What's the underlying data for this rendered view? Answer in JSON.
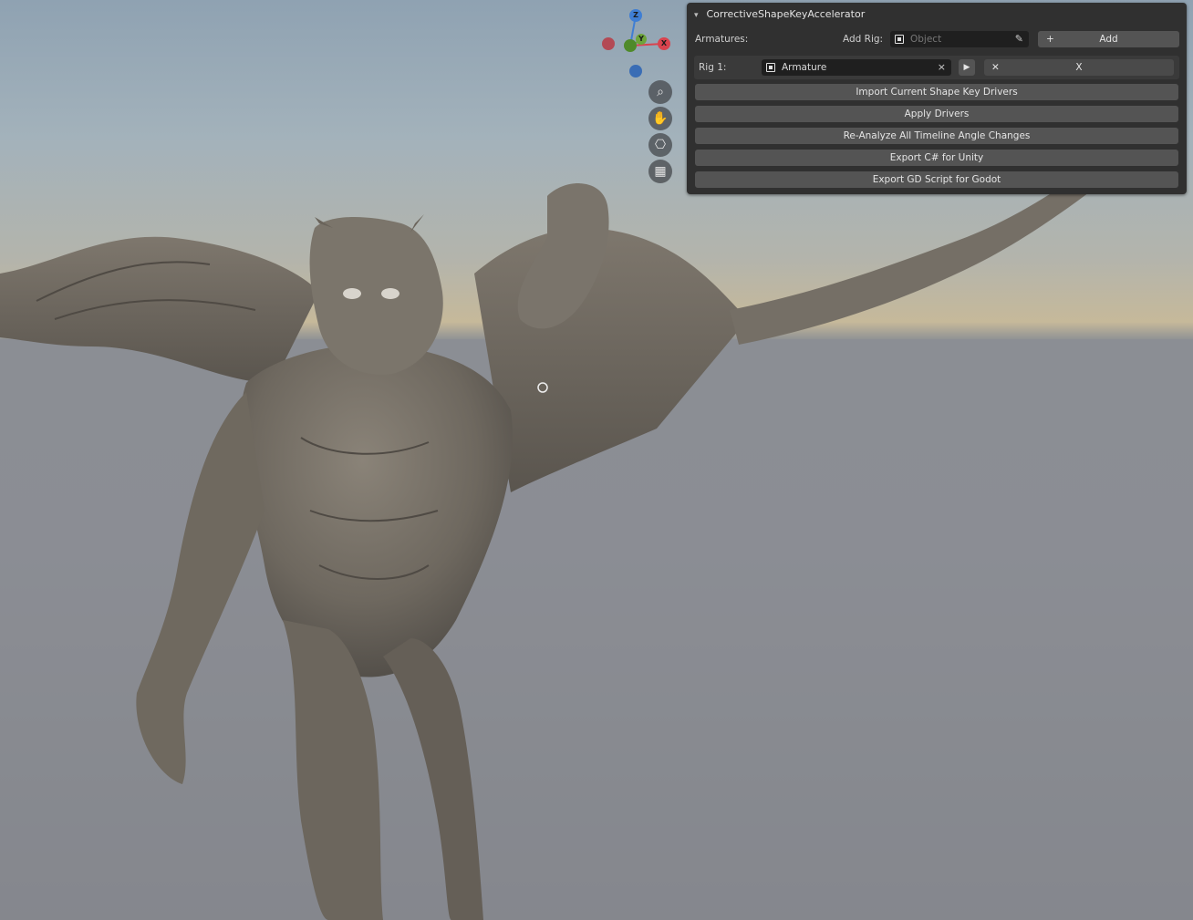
{
  "panel": {
    "title": "CorrectiveShapeKeyAccelerator",
    "armatures_label": "Armatures:",
    "add_rig_label": "Add Rig:",
    "object_placeholder": "Object",
    "add_plus": "+",
    "add_label": "Add",
    "rig": {
      "label": "Rig 1:",
      "armature_value": "Armature",
      "clear_symbol": "×",
      "play_symbol": "▶",
      "x_small": "✕",
      "x_label": "X"
    },
    "buttons": [
      "Import Current Shape Key Drivers",
      "Apply Drivers",
      "Re-Analyze All Timeline Angle Changes",
      "Export C# for Unity",
      "Export GD Script for Godot"
    ]
  },
  "gizmo": {
    "z_label": "Z",
    "y_label": "Y",
    "x_label": "X",
    "colors": {
      "x": "#d9434e",
      "y": "#6da53a",
      "z": "#3f7ed4",
      "neg_x": "#b34a55",
      "neg_z": "#3a6db5"
    }
  },
  "nav_icons": [
    "zoom-icon",
    "pan-hand-icon",
    "camera-icon",
    "grid-icon"
  ],
  "nav_glyphs": [
    "⌕",
    "✋",
    "⎔",
    "▦"
  ]
}
